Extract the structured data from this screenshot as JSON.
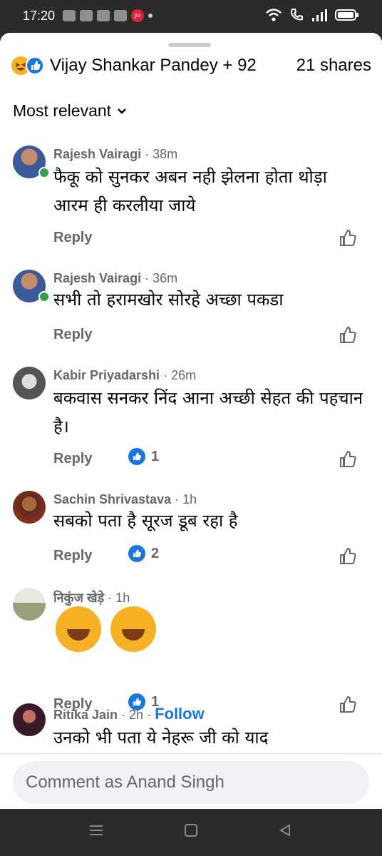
{
  "status": {
    "time": "17:20",
    "carrier": "Jio"
  },
  "header": {
    "reactors": "Vijay Shankar Pandey + 92",
    "shares": "21 shares"
  },
  "sort": {
    "label": "Most relevant"
  },
  "comments": [
    {
      "name": "Rajesh Vairagi",
      "time": " · 38m",
      "text": "फैकू को सुनकर अबन नही झेलना होता थोड़ा आरम ही करलीया जाये",
      "reply": "Reply",
      "likes": ""
    },
    {
      "name": "Rajesh Vairagi",
      "time": " · 36m",
      "text": "सभी तो हरामखोर सोरहे अच्छा पकडा",
      "reply": "Reply",
      "likes": ""
    },
    {
      "name": "Kabir Priyadarshi",
      "time": " · 26m",
      "text": "बकवास सनकर निंद आना अच्छी सेहत की पहचान है।",
      "reply": "Reply",
      "likes": "1"
    },
    {
      "name": "Sachin Shrivastava",
      "time": " · 1h",
      "text": "सबको पता है सूरज डूब रहा है",
      "reply": "Reply",
      "likes": "2"
    },
    {
      "name": "निकुंज खेड़े",
      "time": " · 1h",
      "text": "",
      "reply": "Reply",
      "likes": "1"
    },
    {
      "name": "Ritika Jain",
      "time": " · 2h · ",
      "follow": "Follow",
      "text": "उनको भी पता ये नेहरू जी को याद",
      "reply": "",
      "likes": ""
    }
  ],
  "composer": {
    "placeholder": "Comment as Anand Singh"
  }
}
